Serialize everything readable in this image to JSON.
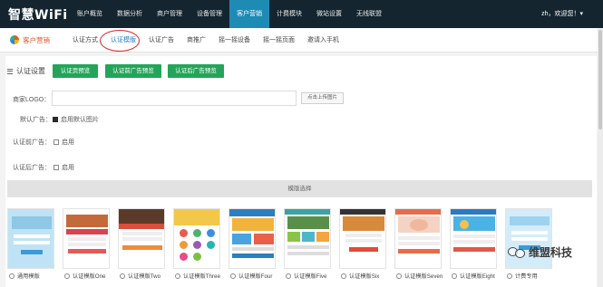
{
  "app": {
    "logo": "智慧WiFi",
    "user": "zh，欢迎您！▾"
  },
  "nav": [
    {
      "label": "账户概览",
      "active": false
    },
    {
      "label": "数据分析",
      "active": false
    },
    {
      "label": "商户管理",
      "active": false
    },
    {
      "label": "设备管理",
      "active": false
    },
    {
      "label": "客户营销",
      "active": true
    },
    {
      "label": "计费模块",
      "active": false
    },
    {
      "label": "微站设置",
      "active": false
    },
    {
      "label": "无线联盟",
      "active": false
    }
  ],
  "subnav": {
    "section": "客户营销",
    "tabs": [
      {
        "label": "认证方式",
        "active": false
      },
      {
        "label": "认证模版",
        "active": true
      },
      {
        "label": "认证广告",
        "active": false
      },
      {
        "label": "商推广",
        "active": false
      },
      {
        "label": "摇一摇设备",
        "active": false
      },
      {
        "label": "摇一摇页面",
        "active": false
      },
      {
        "label": "邀请入手机",
        "active": false
      }
    ]
  },
  "auth": {
    "title": "认证设置",
    "buttons": [
      "认证页预览",
      "认证前广告预览",
      "认证后广告预览"
    ],
    "logo_label": "商家LOGO：",
    "logo_value": "",
    "upload_label": "点击上传图片",
    "default_ad_label": "默认广告：",
    "default_ad_option": "启用默认图片",
    "pre_ad_label": "认证前广告：",
    "pre_ad_option": "启用",
    "post_ad_label": "认证后广告：",
    "post_ad_option": "启用"
  },
  "templates": {
    "bar_label": "模版选择",
    "items": [
      {
        "label": "通用模版"
      },
      {
        "label": "认证模版One"
      },
      {
        "label": "认证模版Two"
      },
      {
        "label": "认证模版Three"
      },
      {
        "label": "认证模版Four"
      },
      {
        "label": "认证模版Five"
      },
      {
        "label": "认证模版Six"
      },
      {
        "label": "认证模版Seven"
      },
      {
        "label": "认证模版Eight"
      },
      {
        "label": "计费专用"
      }
    ]
  },
  "watermark": {
    "text": "维盟科技"
  },
  "colors": {
    "topbar": "#14252f",
    "active_tab": "#1e8bb5",
    "green_button": "#22a55a",
    "brand_orange": "#e8542a",
    "highlight_circle": "#d7262a"
  }
}
